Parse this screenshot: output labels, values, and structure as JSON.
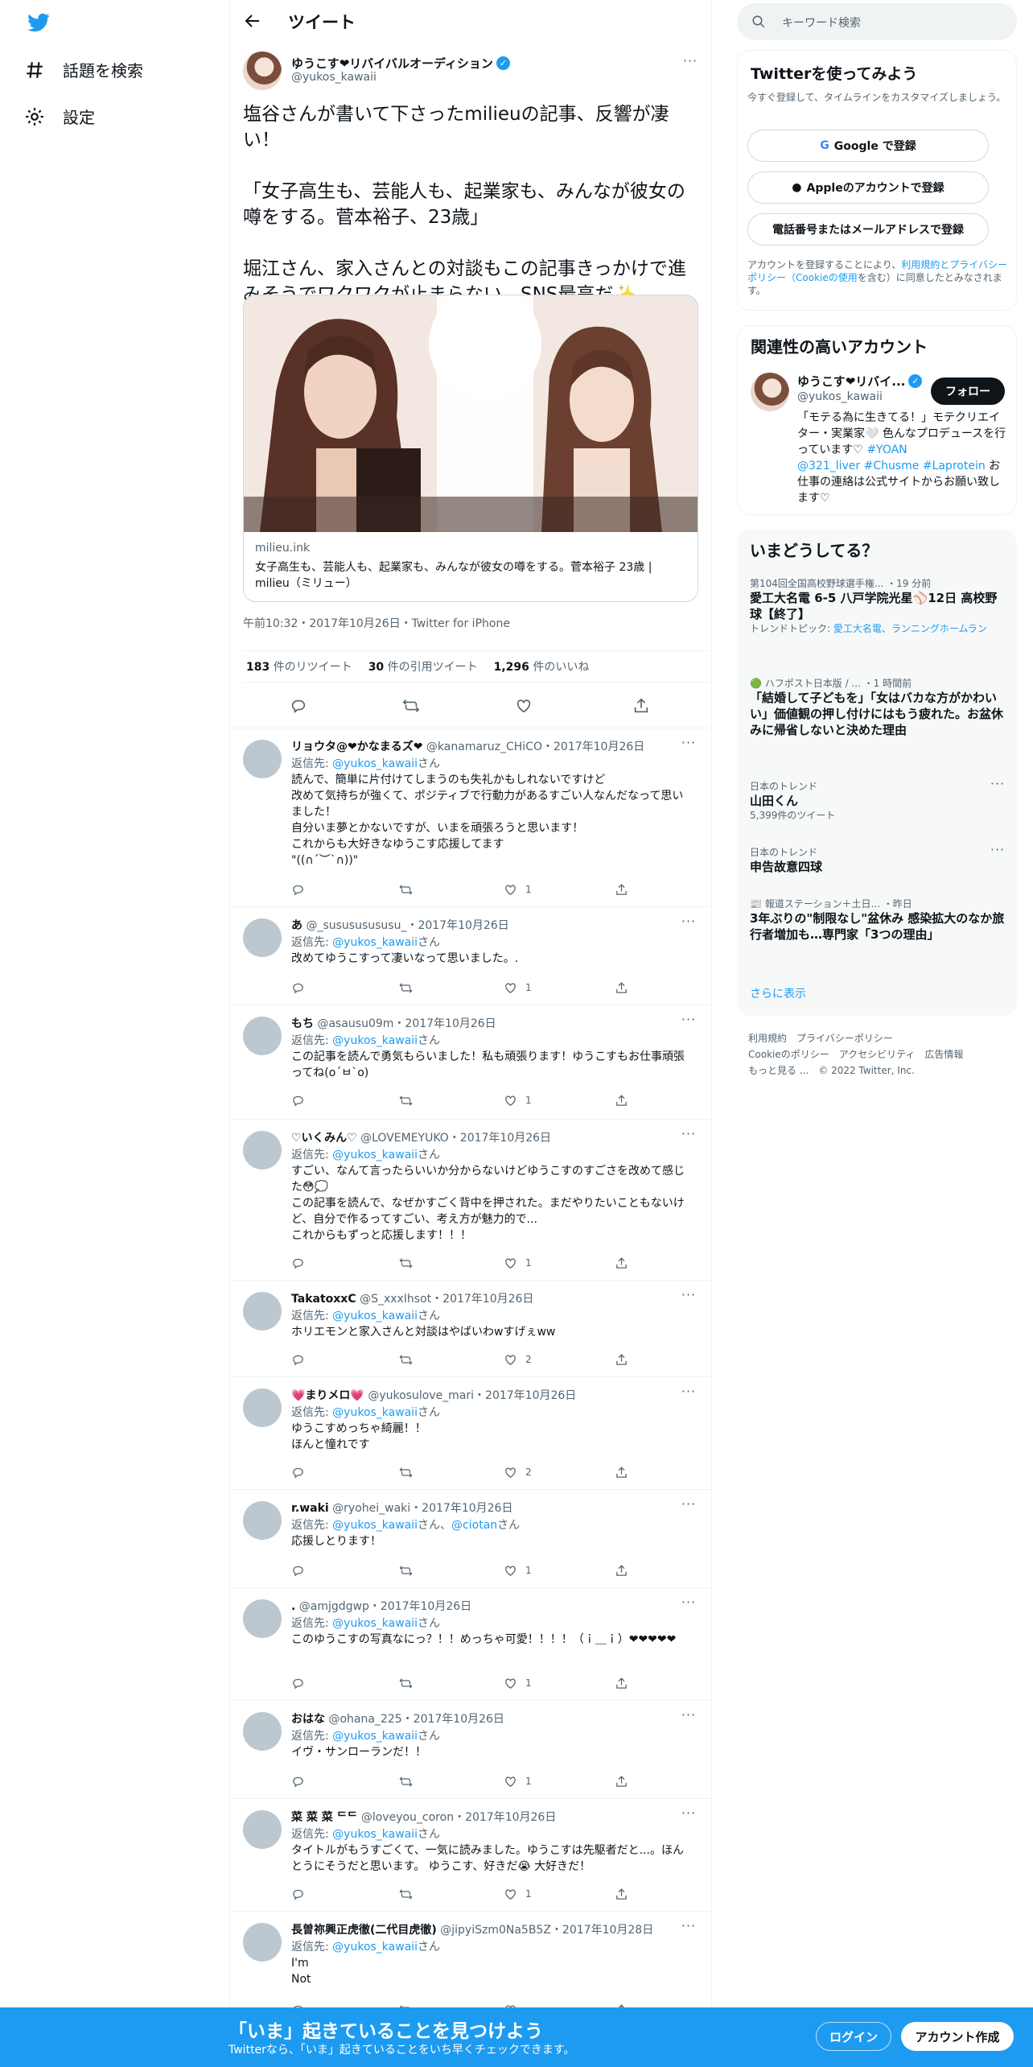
{
  "nav": {
    "explore": "話題を検索",
    "settings": "設定"
  },
  "header": {
    "title": "ツイート"
  },
  "tweet": {
    "name": "ゆうこす❤リバイバルオーディション",
    "handle": "@yukos_kawaii",
    "text": "塩谷さんが書いて下さったmilieuの記事、反響が凄い！\n\n「女子高生も、芸能人も、起業家も、みんなが彼女の噂をする。菅本裕子、23歳」\n\n堀江さん、家入さんとの対談もこの記事きっかけで進みそうでワクワクが止まらない。SNS最高だ✨",
    "card_domain": "milieu.ink",
    "card_title": "女子高生も、芸能人も、起業家も、みんなが彼女の噂をする。菅本裕子 23歳 | milieu（ミリュー）",
    "meta": "午前10:32・2017年10月26日・Twitter for iPhone",
    "retweets": "183",
    "retweets_label": "件のリツイート",
    "quotes": "30",
    "quotes_label": "件の引用ツイート",
    "likes": "1,296",
    "likes_label": "件のいいね"
  },
  "replies": [
    {
      "name": "リョウタ@❤かなまるズ❤",
      "handle": "@kanamaruz_CHiCO",
      "date": "・2017年10月26日",
      "to_label": "返信先:",
      "to": "@yukos_kawaii",
      "suffix": "さん",
      "to2": "",
      "suffix2": "",
      "text": "読んで、簡単に片付けてしまうのも失礼かもしれないですけど\n改めて気持ちが強くて、ポジティブで行動力があるすごい人なんだなって思いました！\n自分いま夢とかないですが、いまを頑張ろうと思います！\nこれからも大好きなゆうこす応援してます\n\"((∩´︶`∩))\"",
      "likes": "1"
    },
    {
      "name": "あ",
      "handle": "@_susususususu_",
      "date": "・2017年10月26日",
      "to_label": "返信先:",
      "to": "@yukos_kawaii",
      "suffix": "さん",
      "to2": "",
      "suffix2": "",
      "text": "改めてゆうこすって凄いなって思いました。.",
      "likes": "1"
    },
    {
      "name": "もち",
      "handle": "@asausu09m",
      "date": "・2017年10月26日",
      "to_label": "返信先:",
      "to": "@yukos_kawaii",
      "suffix": "さん",
      "to2": "",
      "suffix2": "",
      "text": "この記事を読んで勇気もらいました！私も頑張ります！ゆうこすもお仕事頑張ってね(o´ㅂ`o)",
      "likes": "1"
    },
    {
      "name": "♡いくみん♡",
      "handle": "@LOVEMEYUKO",
      "date": "・2017年10月26日",
      "to_label": "返信先:",
      "to": "@yukos_kawaii",
      "suffix": "さん",
      "to2": "",
      "suffix2": "",
      "text": "すごい、なんて言ったらいいか分からないけどゆうこすのすごさを改めて感じた😳💭\nこの記事を読んで、なぜかすごく背中を押された。まだやりたいこともないけど、自分で作るってすごい、考え方が魅力的で...\nこれからもずっと応援します！！！",
      "likes": "1"
    },
    {
      "name": "TakatoxxC",
      "handle": "@S_xxxIhsot",
      "date": "・2017年10月26日",
      "to_label": "返信先:",
      "to": "@yukos_kawaii",
      "suffix": "さん",
      "to2": "",
      "suffix2": "",
      "text": "ホリエモンと家入さんと対談はやばいわwすげぇww",
      "likes": "2"
    },
    {
      "name": "💗まりメロ💗",
      "handle": "@yukosulove_mari",
      "date": "・2017年10月26日",
      "to_label": "返信先:",
      "to": "@yukos_kawaii",
      "suffix": "さん",
      "to2": "",
      "suffix2": "",
      "text": "ゆうこすめっちゃ綺麗！！\nほんと憧れです",
      "likes": "2"
    },
    {
      "name": "r.waki",
      "handle": "@ryohei_waki",
      "date": "・2017年10月26日",
      "to_label": "返信先:",
      "to": "@yukos_kawaii",
      "suffix": "さん、",
      "to2": "@ciotan",
      "suffix2": "さん",
      "text": "応援しとります！",
      "likes": "1"
    },
    {
      "name": ".",
      "handle": "@amjgdgwp",
      "date": "・2017年10月26日",
      "to_label": "返信先:",
      "to": "@yukos_kawaii",
      "suffix": "さん",
      "to2": "",
      "suffix2": "",
      "text": "このゆうこすの写真なにっ？！！めっちゃ可愛！！！！（ｉ＿ｉ）❤❤❤❤❤",
      "likes": "1"
    },
    {
      "name": "おはな",
      "handle": "@ohana_225",
      "date": "・2017年10月26日",
      "to_label": "返信先:",
      "to": "@yukos_kawaii",
      "suffix": "さん",
      "to2": "",
      "suffix2": "",
      "text": "イヴ・サンローランだ！！",
      "likes": "1"
    },
    {
      "name": "菜 菜 菜 ᄃᄃ",
      "handle": "@loveyou_coron",
      "date": "・2017年10月26日",
      "to_label": "返信先:",
      "to": "@yukos_kawaii",
      "suffix": "さん",
      "to2": "",
      "suffix2": "",
      "text": "タイトルがもうすごくて、一気に読みました。ゆうこすは先駆者だと...。ほんとうにそうだと思います。 ゆうこす、好きだ😭 大好きだ！",
      "likes": "1"
    },
    {
      "name": "長曽祢興正虎徹(二代目虎徹)",
      "handle": "@jipyiSzm0Na5B5Z",
      "date": "・2017年10月28日",
      "to_label": "返信先:",
      "to": "@yukos_kawaii",
      "suffix": "さん",
      "to2": "",
      "suffix2": "",
      "text": "I'm\nNot",
      "likes": ""
    }
  ],
  "sidebar": {
    "search_placeholder": "キーワード検索",
    "signup_title": "Twitterを使ってみよう",
    "signup_sub": "今すぐ登録して、タイムラインをカスタマイズしましょう。",
    "google_btn": "Google で登録",
    "apple_btn": "Appleのアカウントで登録",
    "phone_btn": "電話番号またはメールアドレスで登録",
    "terms_pre": "アカウントを登録することにより、",
    "terms_link": "利用規約とプライバシーポリシー（Cookieの使用",
    "terms_post": "を含む）に同意したとみなされます。",
    "related_title": "関連性の高いアカウント",
    "related_name": "ゆうこす❤リバイ...",
    "related_handle": "@yukos_kawaii",
    "follow_btn": "フォロー",
    "related_bio_1": "「モテる為に生きてる！」モテクリエイター・実業家🤍 色んなプロデュースを行っています♡ ",
    "related_bio_tag1": "#YOAN",
    "related_bio_tag2": "@321_liver #Chusme #Laprotein",
    "related_bio_2": " お仕事の連絡は公式サイトからお願い致します♡",
    "trends_title": "いまどうしてる？",
    "trends": [
      {
        "ctx": "第104回全国高校野球選手権... ・19 分前",
        "title": "愛工大名電 6-5 八戸学院光星⚾12日 高校野球【終了】",
        "sub_label": "トレンドトピック: ",
        "sub": "愛工大名電、ランニングホームラン"
      },
      {
        "ctx": "🟢 ハフポスト日本版 / ... ・1 時間前",
        "title": "「結婚して子どもを」「女はバカな方がかわいい」価値観の押し付けにはもう疲れた。お盆休みに帰省しないと決めた理由",
        "sub_label": "",
        "sub": ""
      },
      {
        "ctx": "日本のトレンド",
        "title": "山田くん",
        "sub_label": "",
        "sub": "5,399件のツイート"
      },
      {
        "ctx": "日本のトレンド",
        "title": "申告故意四球",
        "sub_label": "",
        "sub": ""
      },
      {
        "ctx": "📰 報道ステーション＋土日... ・昨日",
        "title": "3年ぶりの\"制限なし\"盆休み 感染拡大のなか旅行者増加も…専門家「3つの理由」",
        "sub_label": "",
        "sub": ""
      }
    ],
    "show_more": "さらに表示",
    "footer_1": "利用規約　プライバシーポリシー",
    "footer_2": "Cookieのポリシー　アクセシビリティ　広告情報",
    "footer_3": "もっと見る ...　© 2022 Twitter, Inc."
  },
  "bottom": {
    "title": "「いま」起きていることを見つけよう",
    "sub": "Twitterなら、「いま」起きていることをいち早くチェックできます。",
    "login": "ログイン",
    "signup": "アカウント作成"
  },
  "colors": {
    "accent": "#1d9bf0",
    "text": "#0f1419",
    "muted": "#536471",
    "border": "#eff3f4"
  }
}
